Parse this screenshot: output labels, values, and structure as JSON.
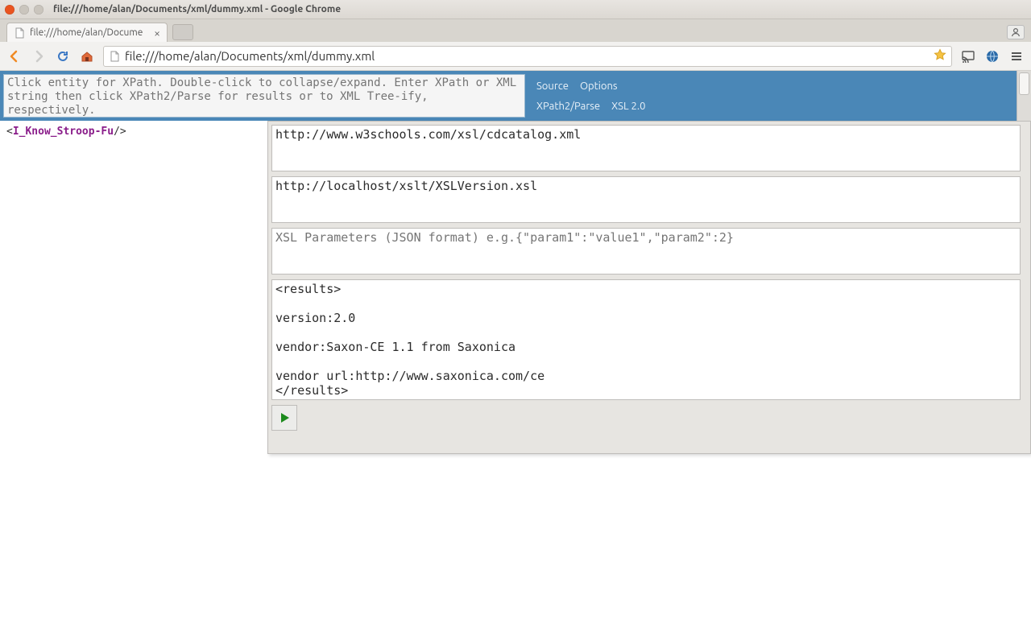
{
  "os": {
    "title": "file:///home/alan/Documents/xml/dummy.xml - Google Chrome"
  },
  "tab": {
    "title": "file:///home/alan/Document"
  },
  "url": "file:///home/alan/Documents/xml/dummy.xml",
  "header": {
    "xpath_placeholder": "Click entity for XPath. Double-click to collapse/expand. Enter XPath or XML string then click XPath2/Parse for results or to XML Tree-ify, respectively.",
    "links": {
      "source": "Source",
      "options": "Options",
      "xpath2parse": "XPath2/Parse",
      "xsl20": "XSL 2.0"
    }
  },
  "xml_tree": {
    "tag_name": "I_Know_Stroop-Fu"
  },
  "fields": {
    "xml_source": "http://www.w3schools.com/xsl/cdcatalog.xml",
    "xsl_source": "http://localhost/xslt/XSLVersion.xsl",
    "xsl_params_placeholder": "XSL Parameters (JSON format) e.g.{\"param1\":\"value1\",\"param2\":2}",
    "results": "<results>\n\nversion:2.0\n\nvendor:Saxon-CE 1.1 from Saxonica\n\nvendor url:http://www.saxonica.com/ce\n</results>"
  }
}
